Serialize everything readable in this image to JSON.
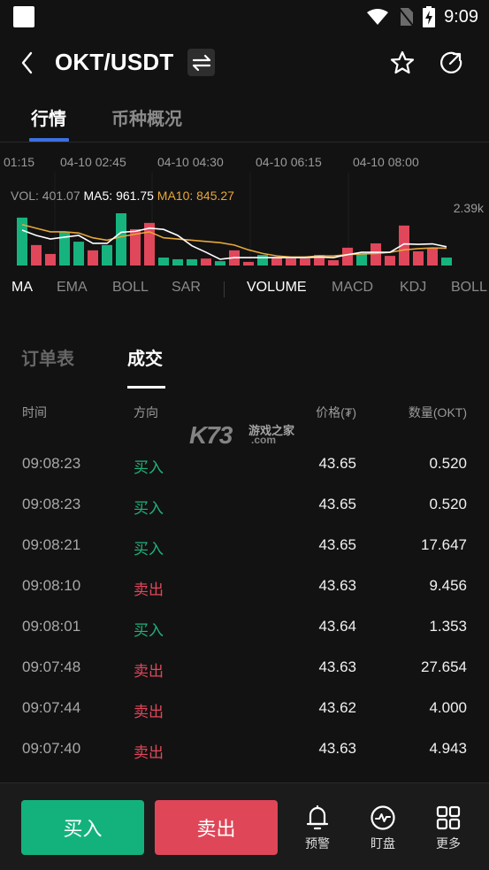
{
  "status_bar": {
    "time": "9:09",
    "icons": [
      "notification-square-icon",
      "wifi-icon",
      "no-sim-icon",
      "battery-charging-icon"
    ]
  },
  "header": {
    "back_icon": "chevron-left-icon",
    "title": "OKT/USDT",
    "swap_icon": "swap-arrows-icon",
    "favorite_icon": "star-icon",
    "share_icon": "share-refresh-icon"
  },
  "main_tabs": [
    {
      "label": "行情",
      "active": true
    },
    {
      "label": "币种概况",
      "active": false
    }
  ],
  "chart": {
    "time_labels": [
      "01:15",
      "04-10 02:45",
      "04-10 04:30",
      "04-10 06:15",
      "04-10 08:00"
    ],
    "legend": {
      "vol": "VOL: 401.07",
      "ma5": "MA5: 961.75",
      "ma10": "MA10: 845.27"
    },
    "max_label": "2.39k"
  },
  "chart_data": {
    "type": "bar",
    "title": "Volume",
    "ylim": [
      0,
      2390
    ],
    "x_tick_labels": [
      "01:15",
      "04-10 02:45",
      "04-10 04:30",
      "04-10 06:15",
      "04-10 08:00"
    ],
    "colors": {
      "up": "#17b37f",
      "down": "#e0475b",
      "ma5": "#ffffff",
      "ma10": "#e7a73a"
    },
    "series": [
      {
        "name": "VOL",
        "values": [
          1990,
          850,
          480,
          1400,
          990,
          630,
          850,
          2170,
          1510,
          1770,
          330,
          260,
          260,
          290,
          180,
          630,
          150,
          440,
          330,
          290,
          290,
          440,
          220,
          740,
          480,
          920,
          400,
          1660,
          590,
          700,
          330
        ],
        "direction": [
          "up",
          "down",
          "down",
          "up",
          "up",
          "down",
          "up",
          "up",
          "down",
          "down",
          "up",
          "up",
          "up",
          "down",
          "up",
          "down",
          "down",
          "up",
          "down",
          "down",
          "down",
          "down",
          "down",
          "down",
          "up",
          "down",
          "down",
          "down",
          "down",
          "down",
          "up"
        ]
      },
      {
        "name": "MA5",
        "values": [
          1470,
          1250,
          1100,
          1180,
          1250,
          920,
          920,
          1380,
          1420,
          1550,
          1500,
          1250,
          820,
          550,
          260,
          330,
          330,
          330,
          330,
          330,
          330,
          350,
          330,
          450,
          550,
          550,
          550,
          900,
          880,
          900,
          780
        ]
      },
      {
        "name": "MA10",
        "values": [
          1700,
          1550,
          1400,
          1400,
          1350,
          1150,
          1050,
          1200,
          1300,
          1400,
          1150,
          1100,
          1050,
          1000,
          950,
          850,
          650,
          500,
          400,
          350,
          350,
          400,
          400,
          450,
          480,
          500,
          550,
          650,
          700,
          730,
          720
        ]
      }
    ]
  },
  "indicator_tabs": {
    "main": [
      {
        "label": "MA",
        "active": true
      },
      {
        "label": "EMA",
        "active": false
      },
      {
        "label": "BOLL",
        "active": false
      },
      {
        "label": "SAR",
        "active": false
      }
    ],
    "sub": [
      {
        "label": "VOLUME",
        "active": true
      },
      {
        "label": "MACD",
        "active": false
      },
      {
        "label": "KDJ",
        "active": false
      },
      {
        "label": "BOLL",
        "active": false
      }
    ]
  },
  "sub_tabs": [
    {
      "label": "订单表",
      "active": false
    },
    {
      "label": "成交",
      "active": true
    }
  ],
  "trades_table": {
    "headers": {
      "time": "时间",
      "side": "方向",
      "price": "价格(₮)",
      "qty": "数量(OKT)"
    },
    "rows": [
      {
        "time": "09:08:23",
        "side": "买入",
        "type": "buy",
        "price": "43.65",
        "qty": "0.520"
      },
      {
        "time": "09:08:23",
        "side": "买入",
        "type": "buy",
        "price": "43.65",
        "qty": "0.520"
      },
      {
        "time": "09:08:21",
        "side": "买入",
        "type": "buy",
        "price": "43.65",
        "qty": "17.647"
      },
      {
        "time": "09:08:10",
        "side": "卖出",
        "type": "sell",
        "price": "43.63",
        "qty": "9.456"
      },
      {
        "time": "09:08:01",
        "side": "买入",
        "type": "buy",
        "price": "43.64",
        "qty": "1.353"
      },
      {
        "time": "09:07:48",
        "side": "卖出",
        "type": "sell",
        "price": "43.63",
        "qty": "27.654"
      },
      {
        "time": "09:07:44",
        "side": "卖出",
        "type": "sell",
        "price": "43.62",
        "qty": "4.000"
      },
      {
        "time": "09:07:40",
        "side": "卖出",
        "type": "sell",
        "price": "43.63",
        "qty": "4.943"
      }
    ]
  },
  "watermark": {
    "brand": "K73",
    "name": "游戏之家",
    "domain": ".com"
  },
  "bottom_bar": {
    "buy_label": "买入",
    "sell_label": "卖出",
    "tools": [
      {
        "label": "预警",
        "icon": "bell-icon"
      },
      {
        "label": "盯盘",
        "icon": "pulse-monitor-icon"
      },
      {
        "label": "更多",
        "icon": "grid-more-icon"
      }
    ],
    "colors": {
      "buy": "#13b27c",
      "sell": "#df4658"
    }
  }
}
